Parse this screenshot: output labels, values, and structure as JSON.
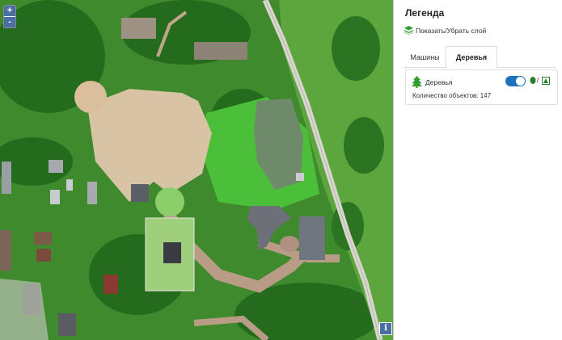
{
  "map": {
    "zoom_in": "+",
    "zoom_out": "-",
    "info": "i"
  },
  "legend": {
    "title": "Легенда",
    "toggle_label": "Показать/Убрать слой",
    "tabs": [
      {
        "label": "Машины",
        "active": false
      },
      {
        "label": "Деревья",
        "active": true
      }
    ],
    "layer": {
      "name": "Деревья",
      "enabled": true,
      "symbol_separator": "/",
      "count_label": "Количество объектов: 147"
    }
  },
  "icons": {
    "layers": "layers-icon",
    "tree": "tree-icon",
    "deciduous": "deciduous-tree-icon",
    "conifer": "conifer-tree-icon",
    "info": "info-icon"
  },
  "colors": {
    "accent": "#1e73be",
    "tree_green": "#2e9e2e",
    "map_control": "#4a6fa5"
  }
}
